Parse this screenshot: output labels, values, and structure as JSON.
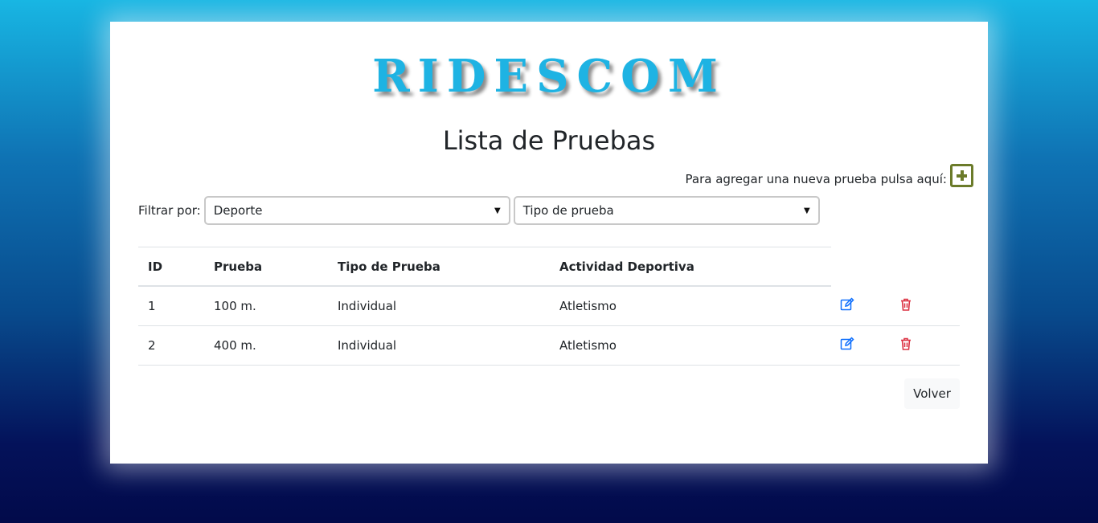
{
  "brand": "RIDESCOM",
  "page_title": "Lista de Pruebas",
  "add_text": "Para agregar una nueva prueba pulsa aquí:",
  "filter": {
    "label": "Filtrar por:",
    "sport_value": "Deporte",
    "type_value": "Tipo de prueba"
  },
  "table": {
    "headers": [
      "ID",
      "Prueba",
      "Tipo de Prueba",
      "Actividad Deportiva"
    ],
    "rows": [
      [
        "1",
        "100 m.",
        "Individual",
        "Atletismo"
      ],
      [
        "2",
        "400 m.",
        "Individual",
        "Atletismo"
      ]
    ]
  },
  "volver_label": "Volver",
  "icons": {
    "add": "plus-square-icon",
    "edit": "edit-icon",
    "delete": "trash-icon"
  },
  "colors": {
    "brand": "#1eb3e3",
    "add": "#6b7b2a",
    "edit": "#0d6efd",
    "delete": "#dc3545"
  }
}
